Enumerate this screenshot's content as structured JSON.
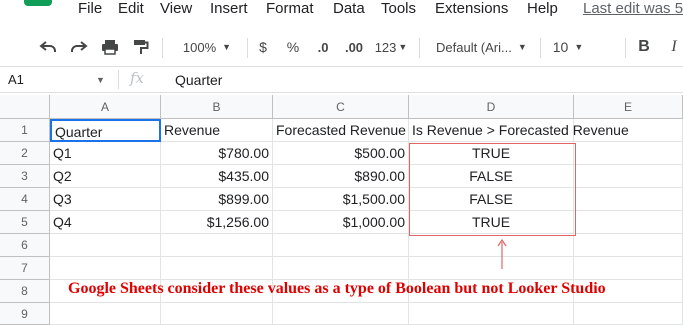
{
  "menu": {
    "items": [
      "File",
      "Edit",
      "View",
      "Insert",
      "Format",
      "Data",
      "Tools",
      "Extensions",
      "Help"
    ],
    "last_edit": "Last edit was 5"
  },
  "toolbar": {
    "zoom": "100%",
    "currency": "$",
    "percent": "%",
    "decrease_decimal": ".0",
    "increase_decimal": ".00",
    "more_formats": "123",
    "font": "Default (Ari...",
    "font_size": "10",
    "bold": "B",
    "italic": "I"
  },
  "formula_bar": {
    "name_box": "A1",
    "fx": "fx",
    "content": "Quarter"
  },
  "sheet": {
    "columns": [
      "A",
      "B",
      "C",
      "D",
      "E"
    ],
    "rows": [
      "1",
      "2",
      "3",
      "4",
      "5",
      "6",
      "7",
      "8",
      "9"
    ],
    "cells": [
      [
        "Quarter",
        "Revenue",
        "Forecasted Revenue",
        "Is Revenue > Forecasted Revenue",
        ""
      ],
      [
        "Q1",
        "$780.00",
        "$500.00",
        "TRUE",
        ""
      ],
      [
        "Q2",
        "$435.00",
        "$890.00",
        "FALSE",
        ""
      ],
      [
        "Q3",
        "$899.00",
        "$1,500.00",
        "FALSE",
        ""
      ],
      [
        "Q4",
        "$1,256.00",
        "$1,000.00",
        "TRUE",
        ""
      ]
    ]
  },
  "annotation": {
    "text": "Google Sheets consider these values as a type of Boolean but not Looker Studio",
    "color": "#e00000"
  },
  "colors": {
    "selection": "#1a73e8",
    "highlight_box": "#e06666",
    "header_bg": "#f8f9fa"
  }
}
